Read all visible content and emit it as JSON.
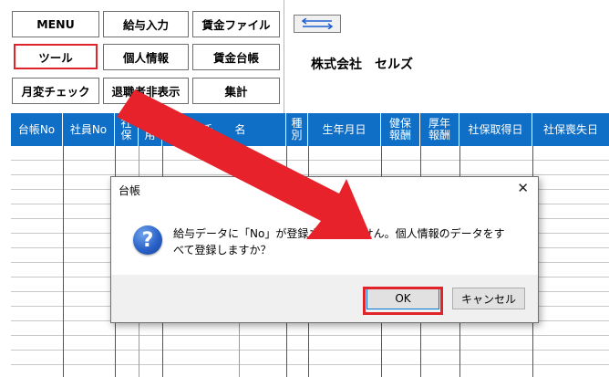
{
  "menu": {
    "buttons": [
      {
        "id": "menu",
        "label": "MENU"
      },
      {
        "id": "payroll_input",
        "label": "給与入力"
      },
      {
        "id": "wage_file",
        "label": "賃金ファイル"
      },
      {
        "id": "tool",
        "label": "ツール"
      },
      {
        "id": "personal_info",
        "label": "個人情報"
      },
      {
        "id": "wage_ledger",
        "label": "賃金台帳"
      },
      {
        "id": "monthly_change_check",
        "label": "月変チェック"
      },
      {
        "id": "hide_retired",
        "label": "退職者非表示"
      },
      {
        "id": "total",
        "label": "集計"
      }
    ]
  },
  "company_name": "株式会社　セルズ",
  "table": {
    "headers": [
      "台帳No",
      "社員No",
      "社\n保",
      "雇\n用",
      "氏　　名",
      "種\n別",
      "生年月日",
      "健保\n報酬",
      "厚年\n報酬",
      "社保取得日",
      "社保喪失日"
    ]
  },
  "dialog": {
    "title": "台帳",
    "message": "給与データに「No」が登録されていません。個人情報のデータをすべて登録しますか？",
    "ok_label": "OK",
    "cancel_label": "キャンセル",
    "icon": "question-icon"
  },
  "colors": {
    "header_bg": "#0f6fc6",
    "highlight": "#e0242a"
  }
}
